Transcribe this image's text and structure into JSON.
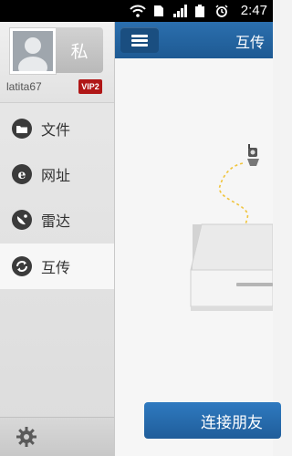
{
  "status_bar": {
    "time": "2:47",
    "icons": [
      "wifi-icon",
      "sim-icon",
      "signal-icon",
      "battery-icon",
      "alarm-icon"
    ]
  },
  "sidebar": {
    "private_label": "私",
    "username": "latita67",
    "vip_badge": "VIP2",
    "items": [
      {
        "label": "文件",
        "icon": "folder-icon"
      },
      {
        "label": "网址",
        "icon": "browser-icon"
      },
      {
        "label": "雷达",
        "icon": "radar-icon"
      },
      {
        "label": "互传",
        "icon": "sync-icon",
        "active": true
      }
    ],
    "settings_icon": "gear-icon"
  },
  "main": {
    "title": "互传",
    "connect_button": "连接朋友"
  },
  "colors": {
    "accent": "#1e5a93",
    "vip": "#b01717"
  }
}
